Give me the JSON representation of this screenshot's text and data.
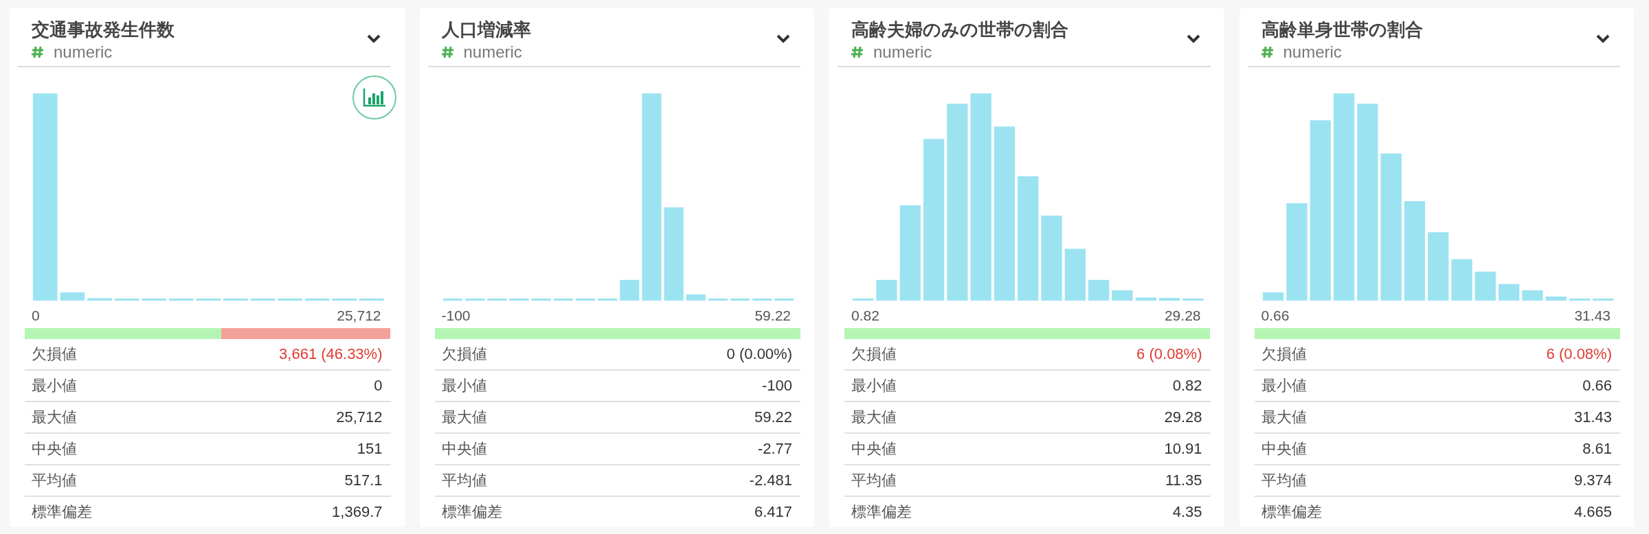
{
  "columns": [
    {
      "title": "交通事故発生件数",
      "type_label": "numeric",
      "chart_toggle": true,
      "axis_min": "0",
      "axis_max": "25,712",
      "coverage": {
        "level": 0.5367
      },
      "stats": [
        {
          "label": "欠損値",
          "value": "3,661 (46.33%)",
          "alert": true
        },
        {
          "label": "最小値",
          "value": "0",
          "alert": false
        },
        {
          "label": "最大値",
          "value": "25,712",
          "alert": false
        },
        {
          "label": "中央値",
          "value": "151",
          "alert": false
        },
        {
          "label": "平均値",
          "value": "517.1",
          "alert": false
        },
        {
          "label": "標準偏差",
          "value": "1,369.7",
          "alert": false
        }
      ]
    },
    {
      "title": "人口増減率",
      "type_label": "numeric",
      "chart_toggle": false,
      "axis_min": "-100",
      "axis_max": "59.22",
      "coverage": {
        "level": 1
      },
      "stats": [
        {
          "label": "欠損値",
          "value": "0 (0.00%)",
          "alert": false
        },
        {
          "label": "最小値",
          "value": "-100",
          "alert": false
        },
        {
          "label": "最大値",
          "value": "59.22",
          "alert": false
        },
        {
          "label": "中央値",
          "value": "-2.77",
          "alert": false
        },
        {
          "label": "平均値",
          "value": "-2.481",
          "alert": false
        },
        {
          "label": "標準偏差",
          "value": "6.417",
          "alert": false
        }
      ]
    },
    {
      "title": "高齢夫婦のみの世帯の割合",
      "type_label": "numeric",
      "chart_toggle": false,
      "axis_min": "0.82",
      "axis_max": "29.28",
      "coverage": {
        "level": 0.9992
      },
      "stats": [
        {
          "label": "欠損値",
          "value": "6 (0.08%)",
          "alert": true
        },
        {
          "label": "最小値",
          "value": "0.82",
          "alert": false
        },
        {
          "label": "最大値",
          "value": "29.28",
          "alert": false
        },
        {
          "label": "中央値",
          "value": "10.91",
          "alert": false
        },
        {
          "label": "平均値",
          "value": "11.35",
          "alert": false
        },
        {
          "label": "標準偏差",
          "value": "4.35",
          "alert": false
        }
      ]
    },
    {
      "title": "高齢単身世帯の割合",
      "type_label": "numeric",
      "chart_toggle": false,
      "axis_min": "0.66",
      "axis_max": "31.43",
      "coverage": {
        "level": 0.9992
      },
      "stats": [
        {
          "label": "欠損値",
          "value": "6 (0.08%)",
          "alert": true
        },
        {
          "label": "最小値",
          "value": "0.66",
          "alert": false
        },
        {
          "label": "最大値",
          "value": "31.43",
          "alert": false
        },
        {
          "label": "中央値",
          "value": "8.61",
          "alert": false
        },
        {
          "label": "平均値",
          "value": "9.374",
          "alert": false
        },
        {
          "label": "標準偏差",
          "value": "4.665",
          "alert": false
        }
      ]
    }
  ]
}
